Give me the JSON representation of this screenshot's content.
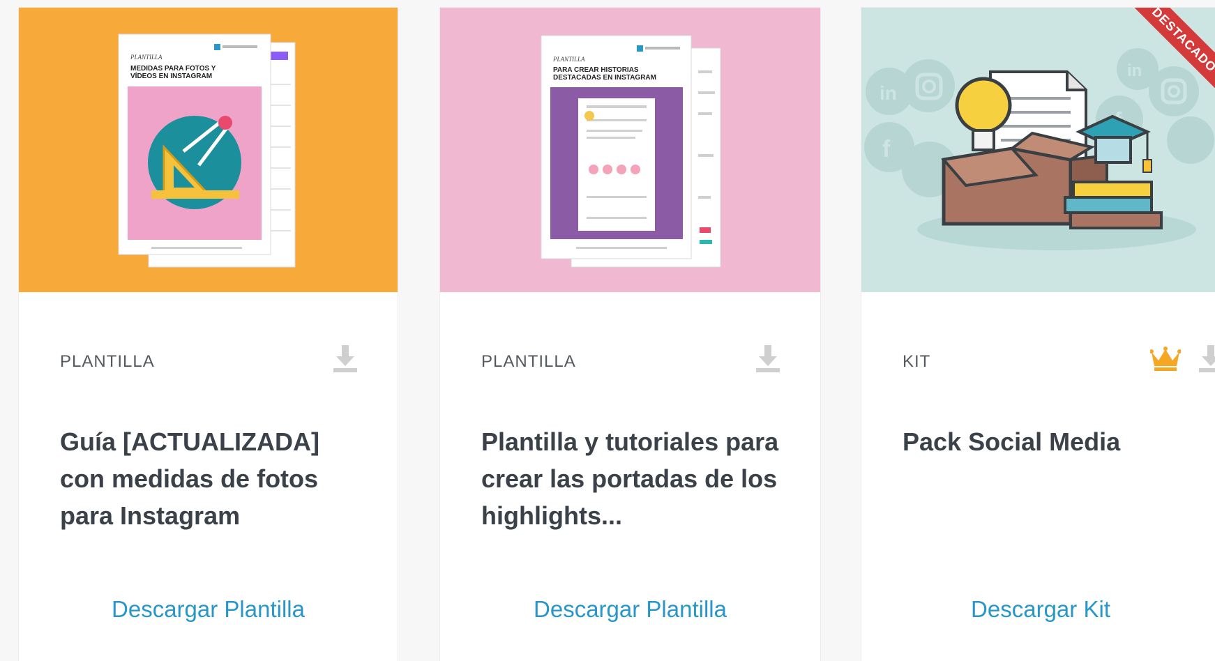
{
  "cards": [
    {
      "type": "PLANTILLA",
      "title": "Guía [ACTUALIZADA] con medidas de fotos para Instagram",
      "cta": "Descargar Plantilla",
      "thumb_bg": "#f7a93a",
      "doc_label": "PLANTILLA",
      "doc_title": "MEDIDAS PARA FOTOS Y VÍDEOS EN INSTAGRAM",
      "icons": [
        "download-icon"
      ]
    },
    {
      "type": "PLANTILLA",
      "title": "Plantilla y tutoriales para crear las portadas de los highlights...",
      "cta": "Descargar Plantilla",
      "thumb_bg": "#f1b8d2",
      "doc_label": "PLANTILLA",
      "doc_title": "PARA CREAR HISTORIAS DESTACADAS EN INSTAGRAM",
      "icons": [
        "download-icon"
      ]
    },
    {
      "type": "KIT",
      "title": "Pack Social Media",
      "cta": "Descargar Kit",
      "thumb_bg": "#cde5e2",
      "ribbon": "DESTACADO",
      "icons": [
        "crown-icon",
        "download-icon"
      ]
    }
  ],
  "colors": {
    "link": "#2796c9",
    "crown": "#f5a623",
    "download_icon": "#cfcfcf",
    "ribbon": "#d53a3a"
  }
}
